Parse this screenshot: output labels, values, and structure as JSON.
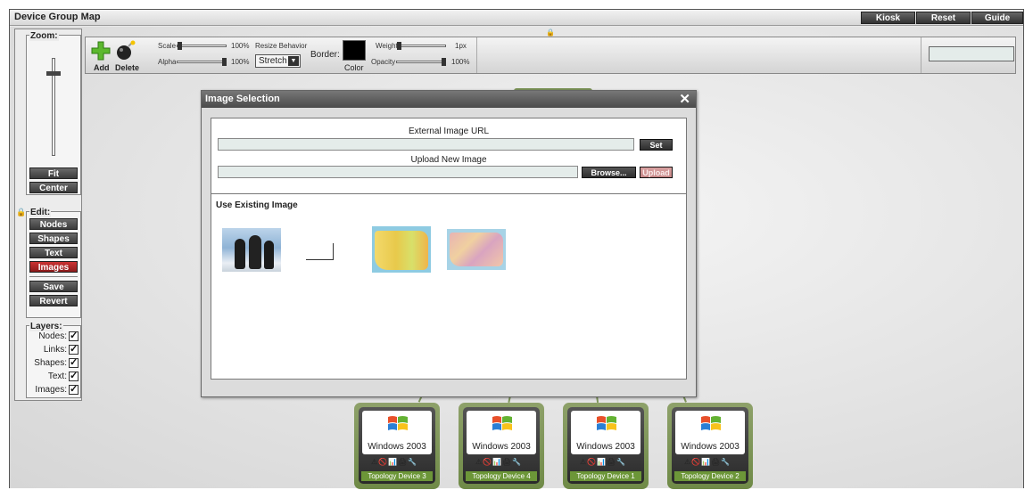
{
  "window": {
    "title": "Device Group Map",
    "buttons": [
      "Kiosk",
      "Reset",
      "Guide"
    ]
  },
  "zoom": {
    "label": "Zoom:",
    "fit_label": "Fit",
    "center_label": "Center"
  },
  "edit": {
    "label": "Edit:",
    "buttons": [
      "Nodes",
      "Shapes",
      "Text",
      "Images"
    ],
    "active": "Images",
    "save_label": "Save",
    "revert_label": "Revert"
  },
  "layers": {
    "label": "Layers:",
    "items": [
      {
        "label": "Nodes:",
        "checked": true
      },
      {
        "label": "Links:",
        "checked": true
      },
      {
        "label": "Shapes:",
        "checked": true
      },
      {
        "label": "Text:",
        "checked": true
      },
      {
        "label": "Images:",
        "checked": true
      }
    ]
  },
  "toolbar": {
    "add_label": "Add",
    "delete_label": "Delete",
    "scale_label": "Scale",
    "scale_value": "100%",
    "alpha_label": "Alpha",
    "alpha_value": "100%",
    "resize_label": "Resize Behavior",
    "resize_value": "Stretch",
    "border_label": "Border:",
    "color_label": "Color",
    "weight_label": "Weight",
    "weight_value": "1px",
    "opacity_label": "Opacity",
    "opacity_value": "100%",
    "border_color": "#000000"
  },
  "dialog": {
    "title": "Image Selection",
    "external_url_label": "External Image URL",
    "external_url_value": "",
    "set_label": "Set",
    "upload_label": "Upload New Image",
    "upload_value": "",
    "browse_label": "Browse...",
    "upload_button": "Upload",
    "existing_label": "Use Existing Image",
    "images": [
      "penguins-thumbnail",
      "blank-image",
      "us-map-thumbnail",
      "us-map-states-thumbnail"
    ]
  },
  "nodes": [
    {
      "os": "Windows 2003",
      "name": "Topology Device 3"
    },
    {
      "os": "Windows 2003",
      "name": "Topology Device 4"
    },
    {
      "os": "Windows 2003",
      "name": "Topology Device 1"
    },
    {
      "os": "Windows 2003",
      "name": "Topology Device 2"
    }
  ],
  "colors": {
    "accent_active": "#b02a2a",
    "node_frame": "#7a9150",
    "node_label_bg": "#6c9638"
  }
}
